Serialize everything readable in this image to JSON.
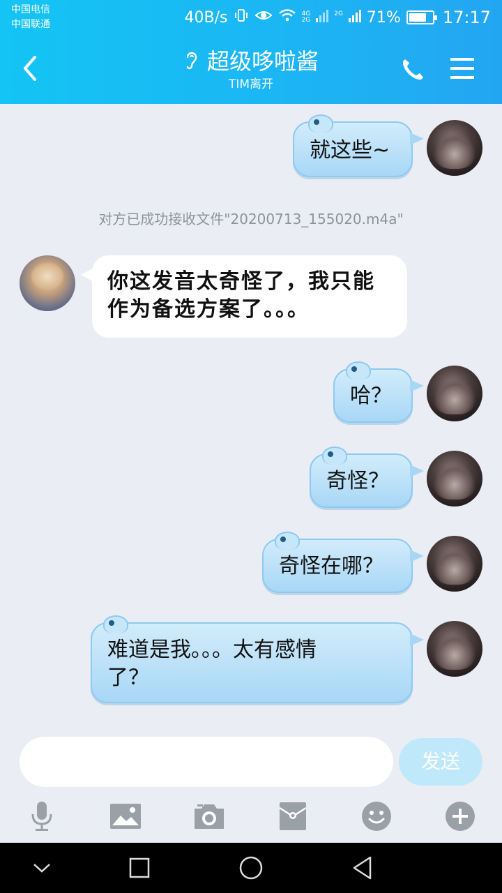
{
  "status_bar": {
    "carrier_1": "中国电信",
    "carrier_2": "中国联通",
    "net_speed": "40B/s",
    "sig_4g": "4G",
    "sig_2g_a": "2G",
    "sig_2g_b": "2G",
    "battery_percent": "71%",
    "battery_level": 0.71,
    "time": "17:17"
  },
  "header": {
    "title": "超级哆啦酱",
    "subtitle": "TIM离开",
    "icons": {
      "back": "chevron-left-icon",
      "ear": "ear-icon",
      "call": "phone-icon",
      "menu": "hamburger-menu-icon"
    }
  },
  "messages": {
    "m1": {
      "sender": "me",
      "text": "就这些~"
    },
    "sys": {
      "text": "对方已成功接收文件\"20200713_155020.m4a\""
    },
    "m2": {
      "sender": "other",
      "line1": "你这发音太奇怪了，我只能",
      "line2": "作为备选方案了。。。"
    },
    "m3": {
      "sender": "me",
      "text": "哈？"
    },
    "m4": {
      "sender": "me",
      "text": "奇怪？"
    },
    "m5": {
      "sender": "me",
      "text": "奇怪在哪？"
    },
    "m6": {
      "sender": "me",
      "line1": "难道是我。。。太有感情",
      "line2": "了？"
    }
  },
  "input": {
    "value": "",
    "placeholder": "",
    "send_label": "发送"
  },
  "toolbar": {
    "icons": [
      "microphone-icon",
      "image-icon",
      "camera-icon",
      "red-packet-icon",
      "emoji-icon",
      "plus-icon"
    ]
  },
  "colors": {
    "header_start": "#14c4f4",
    "header_end": "#23a6f1",
    "bubble_blue": "#a8d7f6",
    "chat_bg": "#eaedf4",
    "send_disabled": "#bfe9fb",
    "icon_gray": "#9aa0a8"
  }
}
